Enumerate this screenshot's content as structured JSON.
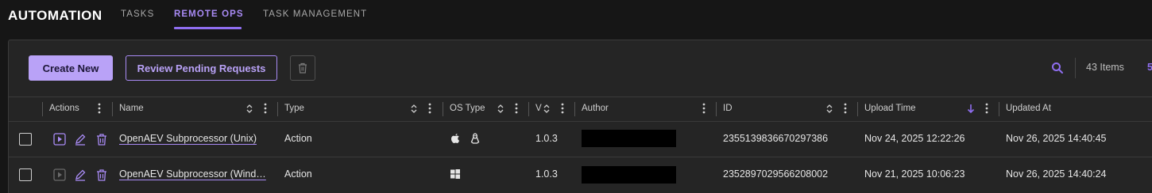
{
  "header": {
    "title": "AUTOMATION",
    "tabs": [
      {
        "label": "TASKS",
        "active": false
      },
      {
        "label": "REMOTE OPS",
        "active": true
      },
      {
        "label": "TASK MANAGEMENT",
        "active": false
      }
    ]
  },
  "toolbar": {
    "create_label": "Create New",
    "review_label": "Review Pending Requests",
    "trash_icon": "trash-icon",
    "search_icon": "search-icon",
    "items_count": "43 Items",
    "items_extra": "5"
  },
  "table": {
    "columns": [
      "Actions",
      "Name",
      "Type",
      "OS Type",
      "V",
      "Author",
      "ID",
      "Upload Time",
      "Updated At"
    ],
    "rows": [
      {
        "name": "OpenAEV Subprocessor (Unix)",
        "type": "Action",
        "os": [
          "apple-icon",
          "linux-icon"
        ],
        "version": "1.0.3",
        "author": "",
        "id": "2355139836670297386",
        "upload_time": "Nov 24, 2025 12:22:26",
        "updated_at": "Nov 26, 2025 14:40:45"
      },
      {
        "name": "OpenAEV Subprocessor (Wind…",
        "type": "Action",
        "os": [
          "windows-icon"
        ],
        "version": "1.0.3",
        "author": "",
        "id": "2352897029566208002",
        "upload_time": "Nov 21, 2025 10:06:23",
        "updated_at": "Nov 26, 2025 14:40:24"
      }
    ]
  },
  "colors": {
    "accent": "#8f6ef0",
    "accent_light": "#b9a2f7",
    "background": "#161616",
    "panel": "#252525"
  }
}
